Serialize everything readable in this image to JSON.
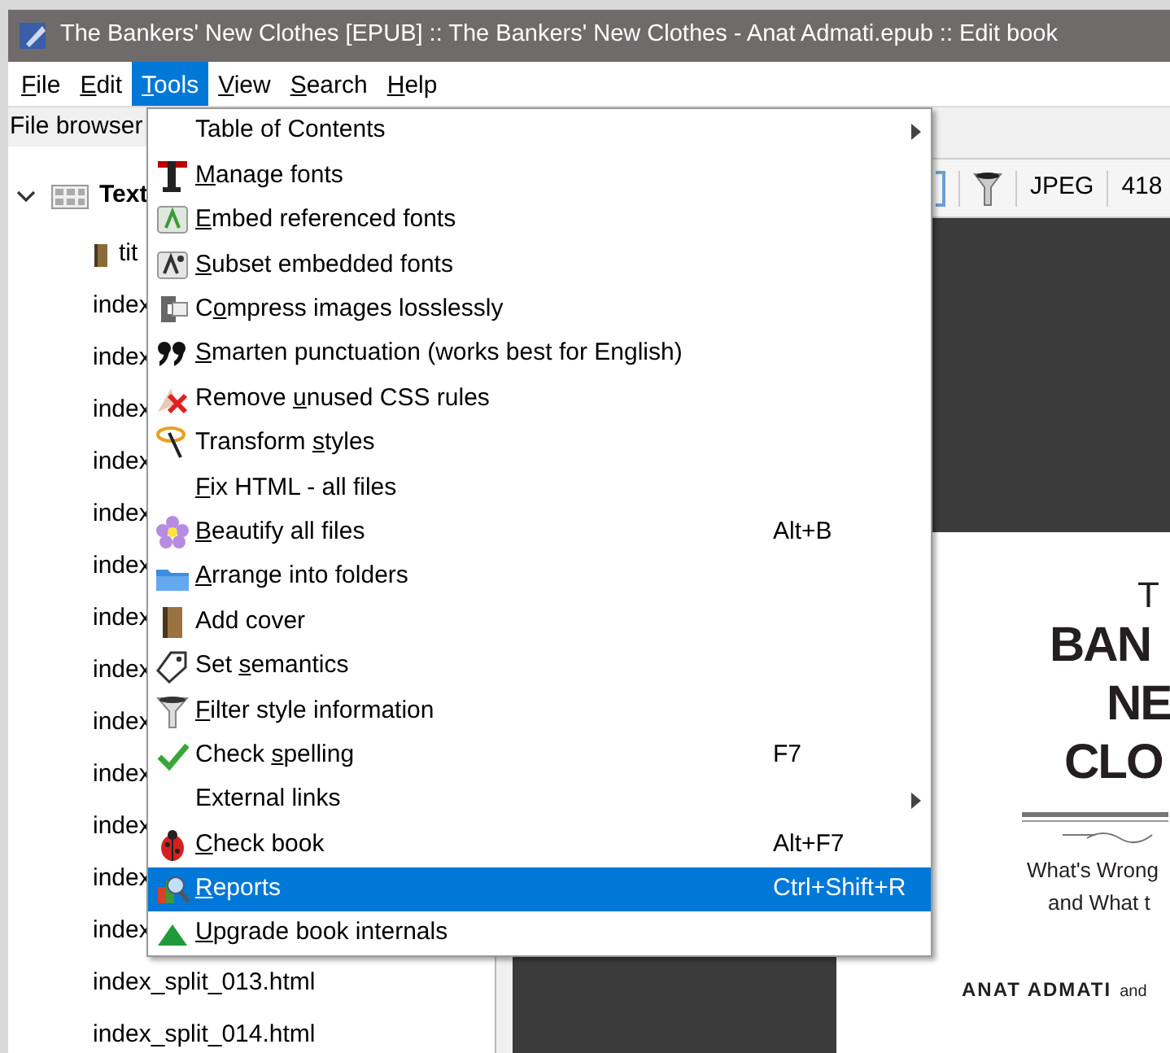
{
  "window": {
    "title": "The Bankers' New Clothes [EPUB] :: The Bankers' New Clothes - Anat Admati.epub :: Edit book"
  },
  "menubar": [
    {
      "key": "F",
      "post": "ile",
      "selected": false
    },
    {
      "key": "E",
      "post": "dit",
      "selected": false
    },
    {
      "key": "T",
      "post": "ools",
      "selected": true
    },
    {
      "key": "V",
      "post": "iew",
      "selected": false
    },
    {
      "key": "S",
      "post": "earch",
      "selected": false
    },
    {
      "key": "H",
      "post": "elp",
      "selected": false
    }
  ],
  "file_browser": {
    "title": "File browser",
    "root": {
      "label": "Text",
      "expanded": true,
      "children": [
        {
          "label": "tit",
          "kind": "cover"
        },
        {
          "label": "index",
          "kind": "file"
        },
        {
          "label": "index",
          "kind": "file"
        },
        {
          "label": "index",
          "kind": "file"
        },
        {
          "label": "index",
          "kind": "file"
        },
        {
          "label": "index",
          "kind": "file"
        },
        {
          "label": "index",
          "kind": "file"
        },
        {
          "label": "index",
          "kind": "file"
        },
        {
          "label": "index",
          "kind": "file"
        },
        {
          "label": "index",
          "kind": "file"
        },
        {
          "label": "index",
          "kind": "file"
        },
        {
          "label": "index",
          "kind": "file"
        },
        {
          "label": "index",
          "kind": "file"
        },
        {
          "label": "index",
          "kind": "file"
        },
        {
          "label": "index_split_013.html",
          "kind": "file"
        },
        {
          "label": "index_split_014.html",
          "kind": "file"
        }
      ]
    }
  },
  "image_toolbar": {
    "format": "JPEG",
    "size": "418"
  },
  "cover_page": {
    "lines": [
      {
        "text": "T",
        "kind": "small-title"
      },
      {
        "text": "BAN",
        "kind": "big-title"
      },
      {
        "text": "NE",
        "kind": "big-title"
      },
      {
        "text": "CLO",
        "kind": "big-title"
      },
      {
        "text": "What's Wrong",
        "kind": "subtitle"
      },
      {
        "text": "and What t",
        "kind": "subtitle"
      }
    ],
    "author": "ANAT ADMATI",
    "author_suffix": "and"
  },
  "tools_menu": [
    {
      "pre": "Table of Contents",
      "has_submenu": true,
      "selected": false
    },
    {
      "key": "M",
      "post": "anage fonts",
      "selected": false
    },
    {
      "key": "E",
      "post": "mbed referenced fonts",
      "selected": false
    },
    {
      "key": "S",
      "post": "ubset embedded fonts",
      "selected": false
    },
    {
      "pre": "C",
      "key": "o",
      "post": "mpress images losslessly",
      "selected": false
    },
    {
      "key": "S",
      "post": "marten punctuation (works best for English)",
      "selected": false
    },
    {
      "pre": "Remove ",
      "key": "u",
      "post": "nused CSS rules",
      "selected": false
    },
    {
      "pre": "Transform ",
      "key": "s",
      "post": "tyles",
      "selected": false
    },
    {
      "key": "F",
      "post": "ix HTML - all files",
      "selected": false
    },
    {
      "key": "B",
      "post": "eautify all files",
      "shortcut": "Alt+B",
      "selected": false
    },
    {
      "key": "A",
      "post": "rrange into folders",
      "selected": false
    },
    {
      "pre": "Add cover",
      "selected": false
    },
    {
      "pre": "Set ",
      "key": "s",
      "post": "emantics",
      "selected": false
    },
    {
      "key": "F",
      "post": "ilter style information",
      "selected": false
    },
    {
      "pre": "Check ",
      "key": "s",
      "post": "pelling",
      "shortcut": "F7",
      "selected": false
    },
    {
      "pre": "External links",
      "has_submenu": true,
      "selected": false
    },
    {
      "key": "C",
      "post": "heck book",
      "shortcut": "Alt+F7",
      "selected": false
    },
    {
      "key": "R",
      "post": "eports",
      "shortcut": "Ctrl+Shift+R",
      "selected": true
    },
    {
      "key": "U",
      "post": "pgrade book internals",
      "selected": false
    }
  ]
}
